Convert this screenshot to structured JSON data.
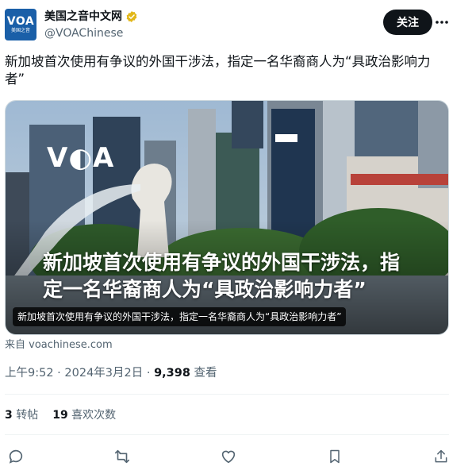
{
  "account": {
    "avatar_text": "VOA",
    "avatar_subtext": "美国之音",
    "display_name": "美国之音中文网",
    "handle": "@VOAChinese",
    "verified": true
  },
  "header": {
    "follow_label": "关注",
    "more_icon": "more-horizontal-icon"
  },
  "tweet": {
    "text": "新加坡首次使用有争议的外国干涉法，指定一名华裔商人为“具政治影响力者”"
  },
  "media": {
    "logo_text": "V◐A",
    "overlay_title": "新加坡首次使用有争议的外国干涉法，指定一名华裔商人为“具政治影响力者”",
    "caption": "新加坡首次使用有争议的外国干涉法，指定一名华裔商人为“具政治影响力者”"
  },
  "source": {
    "text": "来自 voachinese.com"
  },
  "meta": {
    "time": "上午9:52 · 2024年3月2日 · ",
    "views_count": "9,398",
    "views_label": " 查看"
  },
  "stats": {
    "retweets_count": "3",
    "retweets_label": "转帖",
    "likes_count": "19",
    "likes_label": "喜欢次数"
  },
  "actions": [
    "reply-icon",
    "retweet-icon",
    "like-icon",
    "bookmark-icon",
    "share-icon"
  ],
  "colors": {
    "text_primary": "#0f1419",
    "text_secondary": "#536471",
    "verified_gold": "#e2b719",
    "voa_blue": "#1a5fa8"
  }
}
